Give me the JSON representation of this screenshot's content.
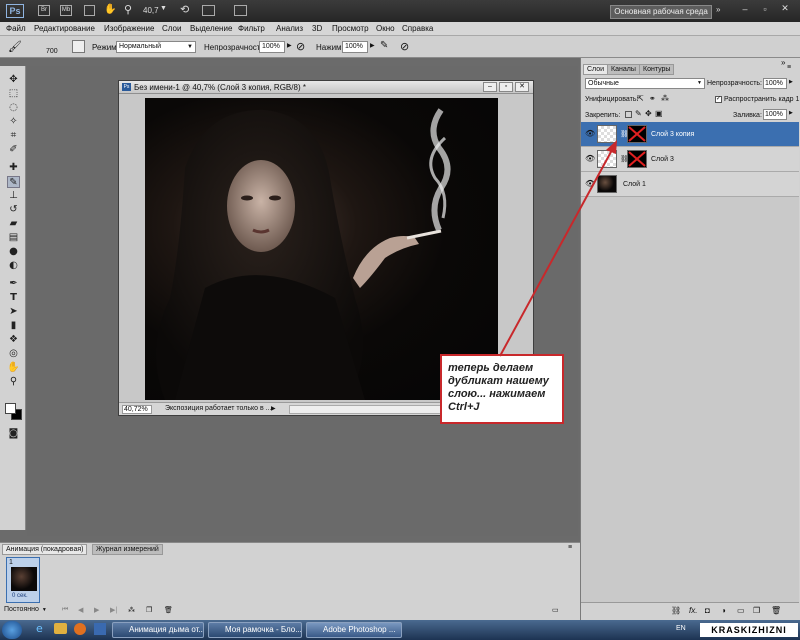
{
  "app": {
    "logo": "Ps",
    "zoom": "40,7",
    "workspace_button": "Основная рабочая среда"
  },
  "menu": [
    "Файл",
    "Редактирование",
    "Изображение",
    "Слои",
    "Выделение",
    "Фильтр",
    "Анализ",
    "3D",
    "Просмотр",
    "Окно",
    "Справка"
  ],
  "options": {
    "brush_size": "700",
    "mode_label": "Режим:",
    "mode_value": "Нормальный",
    "opacity_label": "Непрозрачность:",
    "opacity_value": "100%",
    "pressure_label": "Нажим:",
    "pressure_value": "100%"
  },
  "document": {
    "title": "Без имени-1 @ 40,7% (Слой 3 копия, RGB/8) *",
    "zoom": "40,72%",
    "status": "Экспозиция работает только в ..."
  },
  "layers_panel": {
    "tabs": [
      "Слои",
      "Каналы",
      "Контуры"
    ],
    "blend_mode": "Обычные",
    "opacity_label": "Непрозрачность:",
    "opacity_value": "100%",
    "unify_label": "Унифицировать:",
    "propagate_label": "Распространить кадр 1",
    "fill_label": "Заливка:",
    "fill_value": "100%",
    "lock_label": "Закрепить:",
    "layers": [
      {
        "name": "Слой 3 копия",
        "selected": true
      },
      {
        "name": "Слой 3",
        "selected": false
      },
      {
        "name": "Слой 1",
        "selected": false
      }
    ],
    "bottom_fx": "fx."
  },
  "animation": {
    "tabs": [
      "Анимация (покадровая)",
      "Журнал измерений"
    ],
    "frame_number": "1",
    "frame_time": "0 сек.",
    "loop": "Постоянно"
  },
  "callout": {
    "text": "теперь делаем дубликат  нашему слою... нажимаем Ctrl+J"
  },
  "taskbar": {
    "items": [
      "Анимация дыма от...",
      "Моя рамочка - Бло...",
      "Adobe Photoshop ..."
    ],
    "lang": "EN"
  },
  "watermark": "KRASKIZHIZNI",
  "colors": {
    "accent": "#3b6fb0",
    "callout_border": "#c8282b",
    "arrow": "#c8282b"
  }
}
